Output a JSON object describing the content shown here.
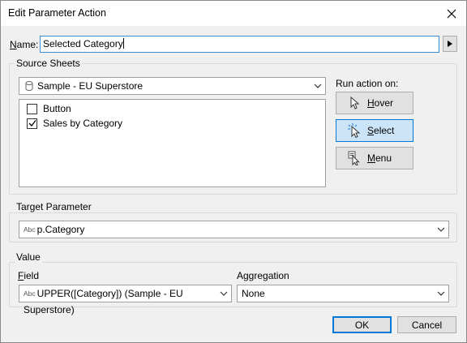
{
  "window": {
    "title": "Edit Parameter Action"
  },
  "name_field": {
    "label": "Name:",
    "value": "Selected Category"
  },
  "source_sheets": {
    "group_title": "Source Sheets",
    "datasource": "Sample - EU Superstore",
    "sheets": [
      {
        "label": "Button",
        "checked": false
      },
      {
        "label": "Sales by Category",
        "checked": true
      }
    ],
    "run_action_label": "Run action on:",
    "run_buttons": [
      {
        "label": "Hover",
        "icon": "pointer-icon",
        "selected": false
      },
      {
        "label": "Select",
        "icon": "pointer-click-icon",
        "selected": true
      },
      {
        "label": "Menu",
        "icon": "pointer-menu-icon",
        "selected": false
      }
    ]
  },
  "target_parameter": {
    "group_title": "Target Parameter",
    "type_badge": "Abc",
    "value": "p.Category"
  },
  "value_group": {
    "group_title": "Value",
    "field_label": "Field",
    "field_value": "UPPER([Category]) (Sample - EU Superstore)",
    "field_type_badge": "Abc",
    "aggregation_label": "Aggregation",
    "aggregation_value": "None"
  },
  "buttons": {
    "ok": "OK",
    "cancel": "Cancel"
  }
}
